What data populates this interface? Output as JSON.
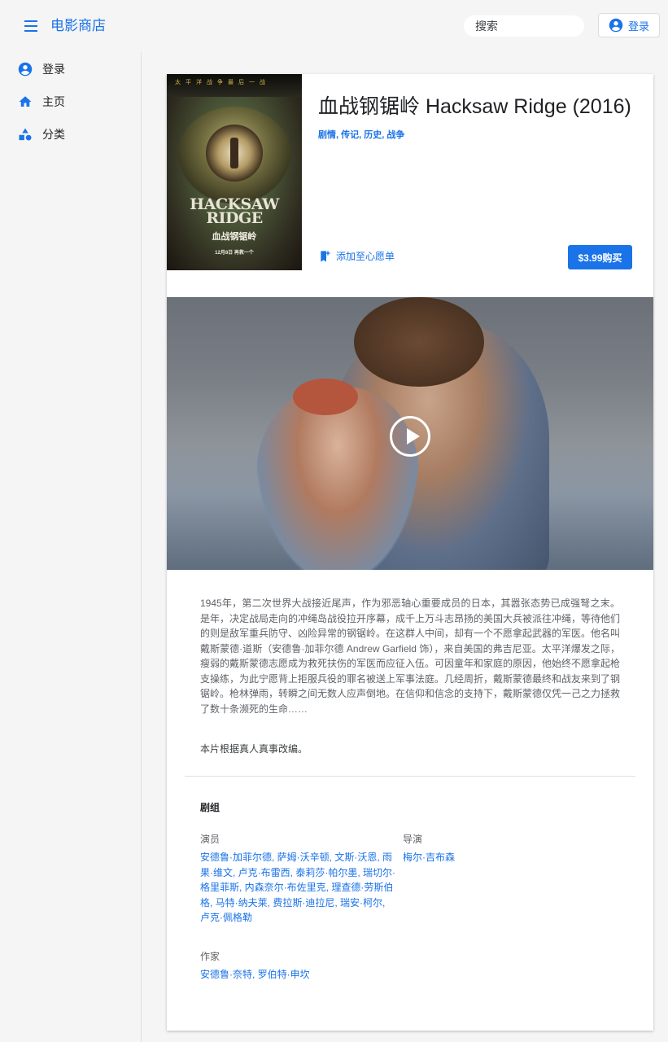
{
  "app": {
    "title": "电影商店"
  },
  "header": {
    "search_placeholder": "搜索",
    "login_label": "登录"
  },
  "sidebar": {
    "items": [
      {
        "label": "登录",
        "icon": "account-circle-icon"
      },
      {
        "label": "主页",
        "icon": "home-icon"
      },
      {
        "label": "分类",
        "icon": "category-icon"
      }
    ]
  },
  "movie": {
    "title": "血战钢锯岭 Hacksaw Ridge (2016)",
    "genres": "剧情, 传记, 历史, 战争",
    "wishlist_label": "添加至心愿单",
    "buy_label": "$3.99购买",
    "poster": {
      "top_text": "太平洋战争最后一战",
      "title_line1": "HACKSAW",
      "title_line2": "RIDGE",
      "title_cn": "血战钢锯岭",
      "date": "12月8日 再救一个"
    },
    "synopsis": "1945年，第二次世界大战接近尾声，作为邪恶轴心重要成员的日本，其嚣张态势已成强弩之末。是年，决定战局走向的冲绳岛战役拉开序幕，成千上万斗志昂扬的美国大兵被派往冲绳，等待他们的则是敌军重兵防守、凶险异常的钢锯岭。在这群人中间，却有一个不愿拿起武器的军医。他名叫戴斯蒙德·道斯（安德鲁·加菲尔德 Andrew Garfield 饰），来自美国的弗吉尼亚。太平洋爆发之际，瘦弱的戴斯蒙德志愿成为救死扶伤的军医而应征入伍。可因童年和家庭的原因，他始终不愿拿起枪支操练，为此宁愿背上拒服兵役的罪名被送上军事法庭。几经周折，戴斯蒙德最终和战友来到了钢锯岭。枪林弹雨，转瞬之间无数人应声倒地。在信仰和信念的支持下，戴斯蒙德仅凭一己之力拯救了数十条濒死的生命……",
    "note": "本片根据真人真事改编。"
  },
  "crew": {
    "title": "剧组",
    "cast_label": "演员",
    "cast": "安德鲁·加菲尔德, 萨姆·沃辛顿, 文斯·沃恩, 雨果·维文, 卢克·布雷西, 泰莉莎·帕尔墨, 瑞切尔·格里菲斯, 内森奈尔·布佐里克, 理查德·劳斯伯格, 马特·纳夫莱, 费拉斯·迪拉尼, 瑞安·柯尔, 卢克·佩格勒",
    "director_label": "导演",
    "director": "梅尔·吉布森",
    "writer_label": "作家",
    "writers": "安德鲁·奈特, 罗伯特·申坎"
  },
  "colors": {
    "accent": "#1a73e8",
    "background": "#f5f5f5"
  }
}
